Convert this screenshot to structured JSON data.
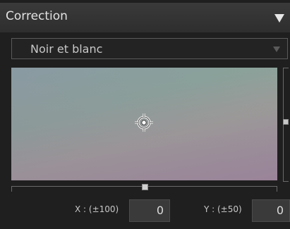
{
  "panel": {
    "title": "Correction"
  },
  "preset_dropdown": {
    "selected": "Noir et blanc"
  },
  "fields": {
    "x_label": "X : (±100)",
    "x_value": "0",
    "y_label": "Y : (±50)",
    "y_value": "0"
  },
  "icons": {
    "collapse": "triangle-down-icon",
    "dropdown": "chevron-down-icon",
    "picker": "crosshair-icon"
  }
}
